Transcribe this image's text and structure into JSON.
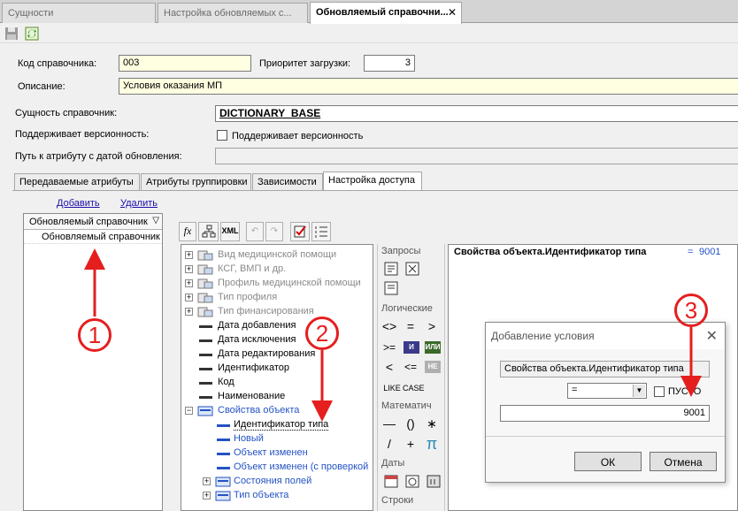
{
  "window_tabs": [
    {
      "label": "Сущности"
    },
    {
      "label": "Настройка обновляемых с..."
    },
    {
      "label": "Обновляемый справочни..."
    }
  ],
  "form": {
    "code_label": "Код справочника:",
    "code_value": "003",
    "priority_label": "Приоритет загрузки:",
    "priority_value": "3",
    "description_label": "Описание:",
    "description_value": "Условия оказания МП",
    "entity_label": "Сущность справочник:",
    "entity_value": "DICTIONARY_BASE",
    "versioning_label": "Поддерживает версионность:",
    "versioning_checkbox_label": "Поддерживает версионность",
    "path_label": "Путь к атрибуту с датой обновления:",
    "path_value": ""
  },
  "inner_tabs": [
    {
      "label": "Передаваемые атрибуты"
    },
    {
      "label": "Атрибуты группировки"
    },
    {
      "label": "Зависимости"
    },
    {
      "label": "Настройка доступа"
    }
  ],
  "left_panel": {
    "add_link": "Добавить",
    "delete_link": "Удалить",
    "column_header": "Обновляемый справочник",
    "rows": [
      "Обновляемый справочник"
    ]
  },
  "expr_toolbar": {
    "fx": "fx",
    "xml": "XML"
  },
  "tree": {
    "items": [
      {
        "label": "Вид медицинской помощи"
      },
      {
        "label": "КСГ, ВМП и др."
      },
      {
        "label": "Профиль медицинской помощи"
      },
      {
        "label": "Тип профиля"
      },
      {
        "label": "Тип финансирования"
      },
      {
        "label": "Дата добавления"
      },
      {
        "label": "Дата исключения"
      },
      {
        "label": "Дата редактирования"
      },
      {
        "label": "Идентификатор"
      },
      {
        "label": "Код"
      },
      {
        "label": "Наименование"
      },
      {
        "label": "Свойства объекта"
      },
      {
        "label": "Идентификатор типа"
      },
      {
        "label": "Новый"
      },
      {
        "label": "Объект изменен"
      },
      {
        "label": "Объект изменен (с проверкой"
      },
      {
        "label": "Состояния полей"
      },
      {
        "label": "Тип объекта"
      }
    ]
  },
  "palette": {
    "sections": [
      "Запросы",
      "Логические",
      "Математич",
      "Даты",
      "Строки"
    ],
    "ops": {
      "ne": "<>",
      "eq": "=",
      "gt": ">",
      "ge": ">=",
      "and": "И",
      "or": "ИЛИ",
      "lt": "<",
      "le": "<=",
      "not": "НЕ",
      "like": "LIKE",
      "case": "CASE",
      "minus": "—",
      "parens": "()",
      "mult": "∗",
      "div": "/",
      "plus": "+",
      "pi": "π"
    }
  },
  "expression": {
    "lhs": "Свойства объекта.Идентификатор типа",
    "op": "=",
    "rhs": "9001"
  },
  "dialog": {
    "title": "Добавление условия",
    "attribute": "Свойства объекта.Идентификатор типа",
    "operator": "=",
    "empty_label": "ПУСТО",
    "value": "9001",
    "ok": "ОК",
    "cancel": "Отмена"
  },
  "markers": [
    "1",
    "2",
    "3"
  ],
  "colors": {
    "marker": "#e51e1e",
    "link": "#1a0dab",
    "tree_blue": "#2452c4",
    "tree_gray": "#8a8a8a",
    "yellow_field": "#ffffe1"
  }
}
